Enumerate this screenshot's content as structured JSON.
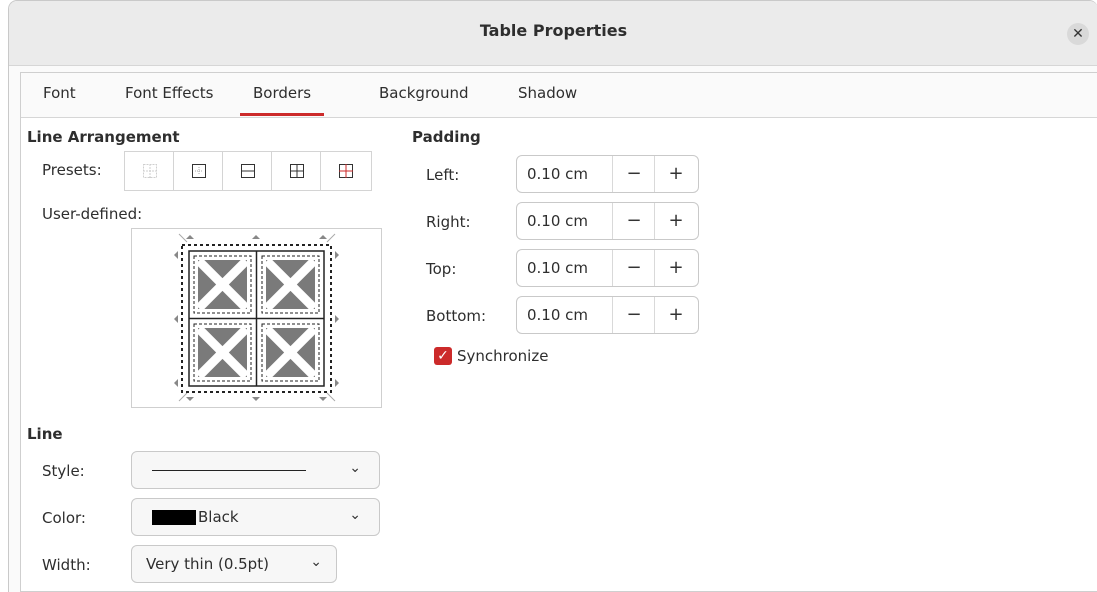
{
  "window": {
    "title": "Table Properties"
  },
  "tabs": [
    {
      "label": "Font"
    },
    {
      "label": "Font Effects"
    },
    {
      "label": "Borders",
      "active": true
    },
    {
      "label": "Background"
    },
    {
      "label": "Shadow"
    }
  ],
  "line_arrangement": {
    "title": "Line Arrangement",
    "presets_label": "Presets:",
    "user_defined_label": "User-defined:"
  },
  "padding": {
    "title": "Padding",
    "fields": [
      {
        "label": "Left:",
        "value": "0.10 cm"
      },
      {
        "label": "Right:",
        "value": "0.10 cm"
      },
      {
        "label": "Top:",
        "value": "0.10 cm"
      },
      {
        "label": "Bottom:",
        "value": "0.10 cm"
      }
    ],
    "minus": "−",
    "plus": "+",
    "synchronize_label": "Synchronize",
    "synchronize_checked": true
  },
  "line": {
    "title": "Line",
    "style_label": "Style:",
    "color_label": "Color:",
    "color_value": "Black",
    "color_swatch": "#000000",
    "width_label": "Width:",
    "width_value": "Very thin (0.5pt)"
  },
  "colors": {
    "accent": "#cc2a2a"
  }
}
